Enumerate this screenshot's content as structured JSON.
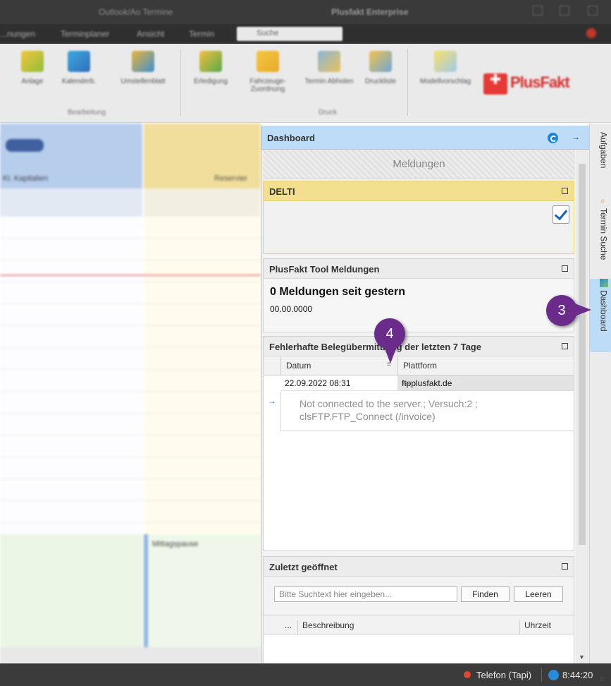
{
  "window": {
    "left_title": "Outlook/Ao Termine",
    "right_title": "Plusfakt Enterprise"
  },
  "menu": {
    "items": [
      "...nungen",
      "Terminplaner",
      "Ansicht",
      "Termin"
    ],
    "search_value": "Suche"
  },
  "ribbon": {
    "items": [
      "Anlage",
      "Kalenderb.",
      "Umstellenblatt",
      "Erledigung",
      "Fahrzeuge-Zuordnung",
      "Termin Abholen",
      "Druckliste",
      "Modellvorschlag"
    ],
    "groups": [
      "Bearbeitung",
      "Druck"
    ],
    "logo_text": "PlusFakt"
  },
  "dashboard": {
    "title": "Dashboard",
    "meldungen_label": "Meldungen",
    "delti": {
      "title": "DELTI"
    },
    "tool": {
      "title": "PlusFakt Tool Meldungen",
      "headline": "0 Meldungen seit gestern",
      "date": "00.00.0000"
    },
    "fehler": {
      "title": "Fehlerhafte Belegübermittlung der letzten 7 Tage",
      "columns": [
        "Datum",
        "Plattform"
      ],
      "row": {
        "datum": "22.09.2022 08:31",
        "plattform": "ftpplusfakt.de",
        "more": "···"
      },
      "detail_line1": "Not connected to the server.; Versuch:2 ;",
      "detail_line2": "clsFTP.FTP_Connect (/invoice)"
    },
    "zuletzt": {
      "title": "Zuletzt geöffnet",
      "search_placeholder": "Bitte Suchtext hier eingeben...",
      "find_label": "Finden",
      "clear_label": "Leeren",
      "columns": [
        "...",
        "Beschreibung",
        "Uhrzeit"
      ]
    }
  },
  "side_tabs": {
    "aufgaben": "Aufgaben",
    "termin_suche": "Termin Suche",
    "dashboard": "Dashboard"
  },
  "callouts": {
    "c3": "3",
    "c4": "4"
  },
  "status": {
    "phone": "Telefon (Tapi)",
    "time": "8:44:20"
  },
  "left_background": {
    "col1_header": "Kl. Kapitalien",
    "col2_header": "Reservier",
    "bottom_label": "Mittagspause"
  },
  "colors": {
    "accent_blue": "#bcdcf7",
    "delti_yellow": "#f3e08e",
    "callout_purple": "#6a2b8b",
    "status_bar": "#3b3b3b"
  }
}
